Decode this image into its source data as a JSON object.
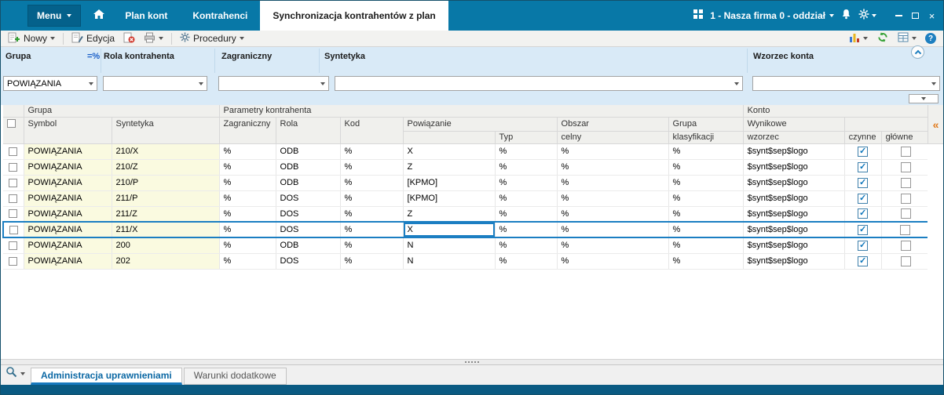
{
  "titlebar": {
    "menu_label": "Menu",
    "tabs": [
      {
        "label": "Plan kont"
      },
      {
        "label": "Kontrahenci"
      },
      {
        "label": "Synchronizacja kontrahentów z plan"
      }
    ],
    "active_tab_index": 2,
    "company_selector": "1 - Nasza firma 0 - oddział"
  },
  "toolbar": {
    "new_label": "Nowy",
    "edit_label": "Edycja",
    "procedures_label": "Procedury"
  },
  "filter_panel": {
    "grupa": {
      "label": "Grupa",
      "operator": "=%",
      "value": "POWIĄZANIA"
    },
    "rola": {
      "label": "Rola kontrahenta",
      "value": ""
    },
    "zagraniczny": {
      "label": "Zagraniczny",
      "value": ""
    },
    "syntetyka": {
      "label": "Syntetyka",
      "value": ""
    },
    "wzorzec": {
      "label": "Wzorzec konta",
      "value": ""
    }
  },
  "grid": {
    "group_headers": {
      "grupa": "Grupa",
      "parametry": "Parametry kontrahenta",
      "konto": "Konto"
    },
    "columns": {
      "symbol": "Symbol",
      "syntetyka": "Syntetyka",
      "zagraniczny": "Zagraniczny",
      "rola": "Rola",
      "kod": "Kod",
      "powiazanie": "Powiązanie",
      "typ": "Typ",
      "obszar_1": "Obszar",
      "obszar_2": "celny",
      "grupa_1": "Grupa",
      "grupa_2": "klasyfikacji",
      "wynikowe": "Wynikowe",
      "wzorzec": "wzorzec",
      "czynne": "czynne",
      "glowne": "główne"
    },
    "selected_row_index": 5,
    "rows": [
      {
        "symbol": "POWIĄZANIA",
        "syntetyka": "210/X",
        "zagraniczny": "%",
        "rola": "ODB",
        "kod": "%",
        "powiazanie": "X",
        "typ": "%",
        "obszar_celny": "%",
        "grupa_klasyfikacji": "%",
        "wzorzec": "$synt$sep$logo",
        "czynne": true,
        "glowne": false
      },
      {
        "symbol": "POWIĄZANIA",
        "syntetyka": "210/Z",
        "zagraniczny": "%",
        "rola": "ODB",
        "kod": "%",
        "powiazanie": "Z",
        "typ": "%",
        "obszar_celny": "%",
        "grupa_klasyfikacji": "%",
        "wzorzec": "$synt$sep$logo",
        "czynne": true,
        "glowne": false
      },
      {
        "symbol": "POWIĄZANIA",
        "syntetyka": "210/P",
        "zagraniczny": "%",
        "rola": "ODB",
        "kod": "%",
        "powiazanie": "[KPMO]",
        "typ": "%",
        "obszar_celny": "%",
        "grupa_klasyfikacji": "%",
        "wzorzec": "$synt$sep$logo",
        "czynne": true,
        "glowne": false
      },
      {
        "symbol": "POWIĄZANIA",
        "syntetyka": "211/P",
        "zagraniczny": "%",
        "rola": "DOS",
        "kod": "%",
        "powiazanie": "[KPMO]",
        "typ": "%",
        "obszar_celny": "%",
        "grupa_klasyfikacji": "%",
        "wzorzec": "$synt$sep$logo",
        "czynne": true,
        "glowne": false
      },
      {
        "symbol": "POWIĄZANIA",
        "syntetyka": "211/Z",
        "zagraniczny": "%",
        "rola": "DOS",
        "kod": "%",
        "powiazanie": "Z",
        "typ": "%",
        "obszar_celny": "%",
        "grupa_klasyfikacji": "%",
        "wzorzec": "$synt$sep$logo",
        "czynne": true,
        "glowne": false
      },
      {
        "symbol": "POWIĄZANIA",
        "syntetyka": "211/X",
        "zagraniczny": "%",
        "rola": "DOS",
        "kod": "%",
        "powiazanie": "X",
        "typ": "%",
        "obszar_celny": "%",
        "grupa_klasyfikacji": "%",
        "wzorzec": "$synt$sep$logo",
        "czynne": true,
        "glowne": false
      },
      {
        "symbol": "POWIĄZANIA",
        "syntetyka": "200",
        "zagraniczny": "%",
        "rola": "ODB",
        "kod": "%",
        "powiazanie": "N",
        "typ": "%",
        "obszar_celny": "%",
        "grupa_klasyfikacji": "%",
        "wzorzec": "$synt$sep$logo",
        "czynne": true,
        "glowne": false
      },
      {
        "symbol": "POWIĄZANIA",
        "syntetyka": "202",
        "zagraniczny": "%",
        "rola": "DOS",
        "kod": "%",
        "powiazanie": "N",
        "typ": "%",
        "obszar_celny": "%",
        "grupa_klasyfikacji": "%",
        "wzorzec": "$synt$sep$logo",
        "czynne": true,
        "glowne": false
      }
    ]
  },
  "icons": {
    "collapse_right": "«",
    "check": "✓",
    "close": "×"
  },
  "bottom_panel": {
    "tabs": [
      {
        "label": "Administracja uprawnieniami",
        "active": true
      },
      {
        "label": "Warunki dodatkowe",
        "active": false
      }
    ]
  }
}
